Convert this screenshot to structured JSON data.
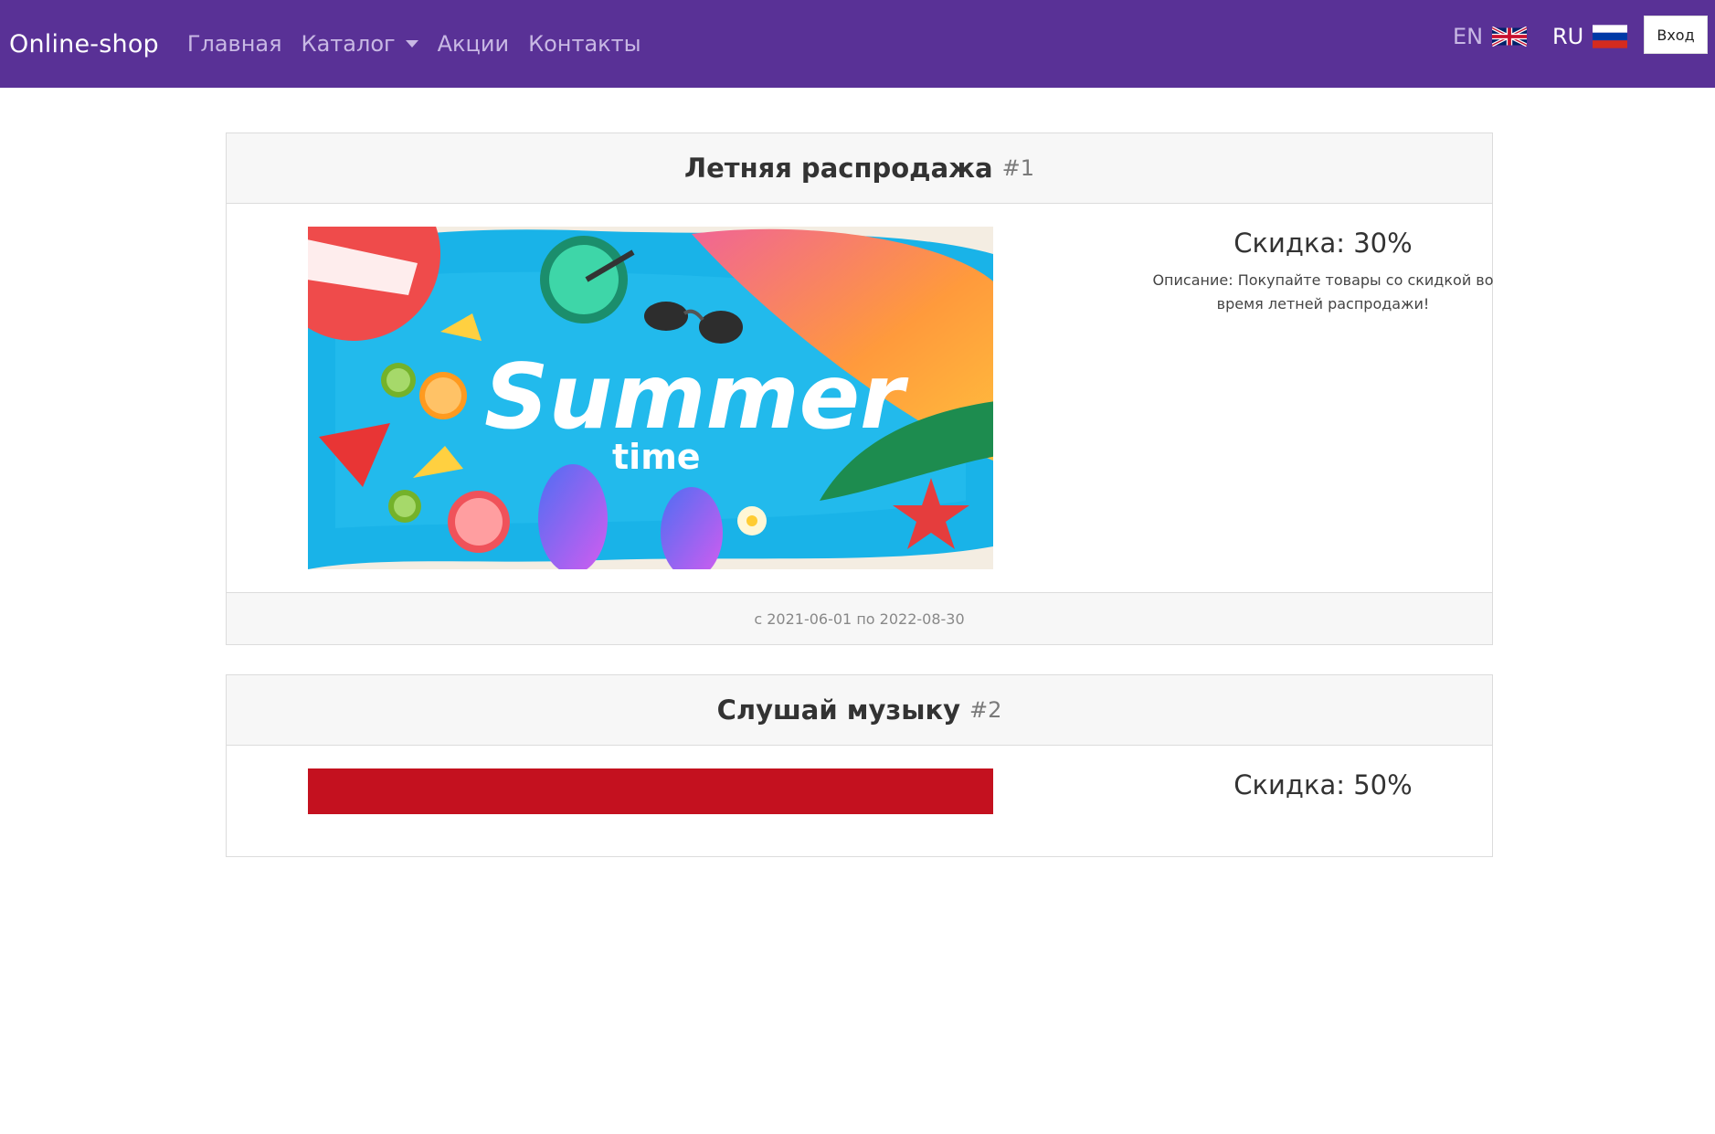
{
  "navbar": {
    "brand": "Online-shop",
    "links": [
      "Главная",
      "Каталог",
      "Акции",
      "Контакты"
    ],
    "lang_en": "EN",
    "lang_ru": "RU",
    "login": "Вход",
    "color": "#593196"
  },
  "promotions": [
    {
      "title": "Летняя распродажа",
      "number": "#1",
      "discount": "Скидка: 30%",
      "description": "Описание: Покупайте товары со скидкой во время летней распродажи!",
      "image_text_main": "Summer",
      "image_text_sub": "time",
      "dates": "с 2021-06-01 по 2022-08-30"
    },
    {
      "title": "Слушай музыку",
      "number": "#2",
      "discount": "Скидка: 50%"
    }
  ]
}
